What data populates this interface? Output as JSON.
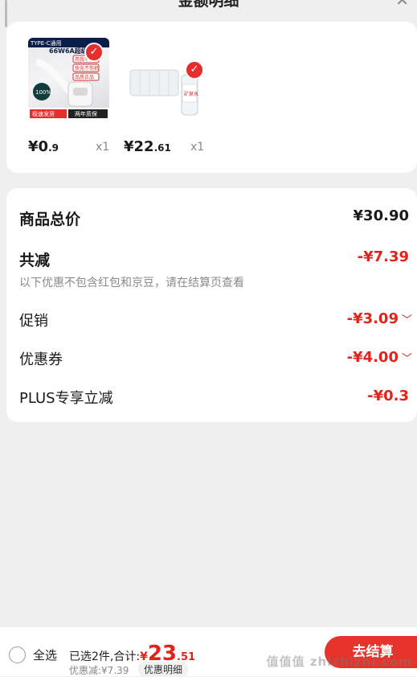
{
  "header": {
    "title": "金额明细",
    "close_icon": "close-icon"
  },
  "products": [
    {
      "image_texts": [
        "TYPE-C通用",
        "66W6A超级快充",
        "用我不伤机",
        "快充不伤机",
        "品质正品",
        "100%",
        "极速发货",
        "两年质保"
      ],
      "price_int": "¥0",
      "price_dec": ".9",
      "qty": "x1",
      "selected": true
    },
    {
      "image_texts": [
        "矿泉水"
      ],
      "price_int": "¥22",
      "price_dec": ".61",
      "qty": "x1",
      "selected": true
    }
  ],
  "summary": {
    "total_label": "商品总价",
    "total_value": "¥30.90",
    "reduce_label": "共减",
    "reduce_value": "-¥7.39",
    "note": "以下优惠不包含红包和京豆，请在结算页查看",
    "rows": [
      {
        "label": "促销",
        "value": "-¥3.09",
        "chevron": "chevron-down-icon"
      },
      {
        "label": "优惠券",
        "value": "-¥4.00",
        "chevron": "chevron-down-icon"
      },
      {
        "label": "PLUS专享立减",
        "value": "-¥0.3"
      }
    ]
  },
  "bottom": {
    "select_all": "全选",
    "selected_text": "已选2件,合计:",
    "currency": "¥",
    "total_int": "23",
    "total_dec": ".51",
    "discount_text": "优惠减:¥7.39",
    "detail_button": "优惠明细",
    "checkout_button": "去结算",
    "watermark": "值值值 zhizhizhi.com"
  },
  "colors": {
    "accent": "#e2231a",
    "badge": "#e62e2e",
    "background": "#efefef"
  }
}
